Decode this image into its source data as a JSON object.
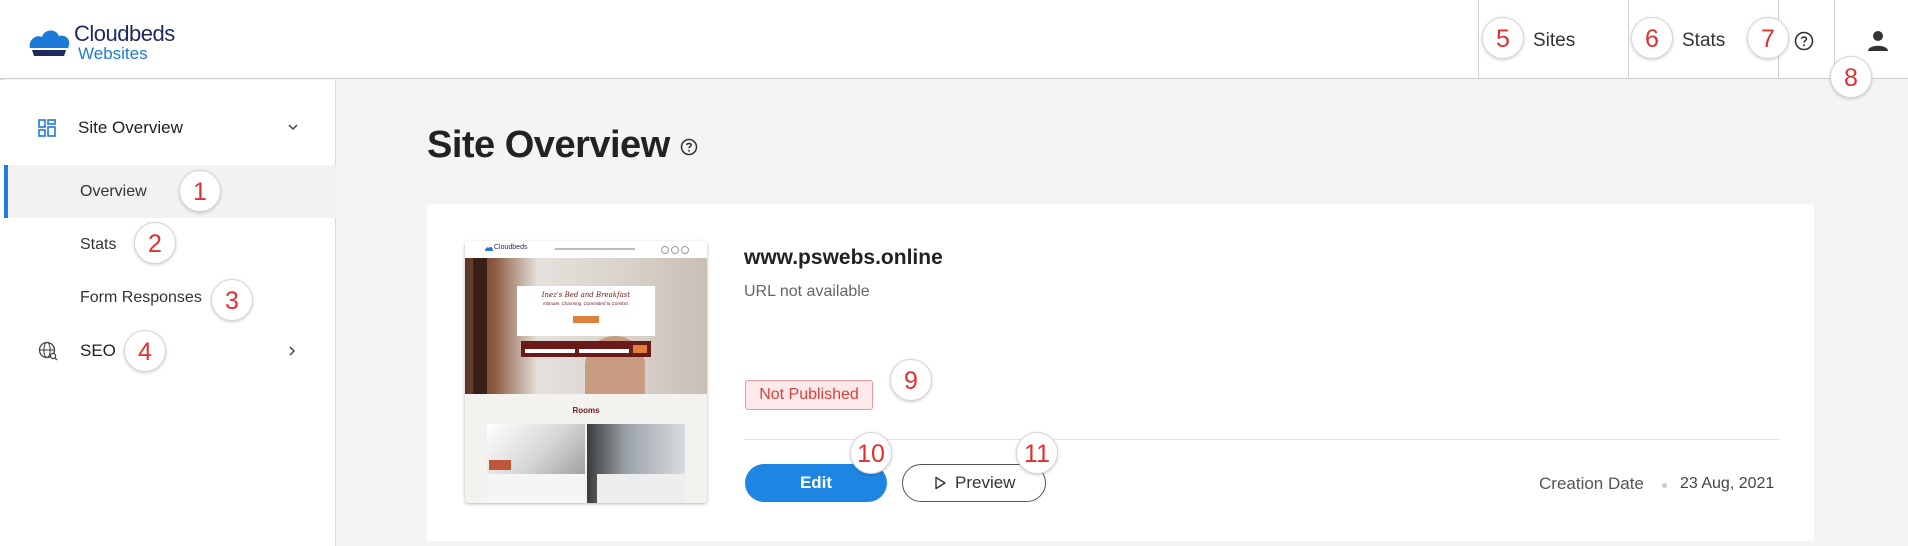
{
  "brand": {
    "name_line1": "Cloudbeds",
    "name_line2": "Websites",
    "primary_color": "#1e86e2",
    "navy": "#1c2b5a"
  },
  "header": {
    "sites_label": "Sites",
    "stats_label": "Stats",
    "help_icon": "question-circle-icon",
    "user_icon": "user-icon"
  },
  "sidebar": {
    "site_overview": "Site Overview",
    "items": [
      {
        "label": "Overview"
      },
      {
        "label": "Stats"
      },
      {
        "label": "Form Responses"
      }
    ],
    "seo": "SEO"
  },
  "main": {
    "title": "Site Overview",
    "site": {
      "name": "www.pswebs.online",
      "url_status": "URL not available",
      "status_badge": "Not Published",
      "edit_label": "Edit",
      "preview_label": "Preview",
      "creation_label": "Creation Date",
      "creation_date": "23 Aug, 2021"
    },
    "thumbnail": {
      "logo": "Cloudbeds",
      "hero_title": "Inez's Bed and Breakfast",
      "hero_subtitle": "Intimate. Charming. Committed to Comfort.",
      "section": "Rooms"
    }
  },
  "annotations": [
    "1",
    "2",
    "3",
    "4",
    "5",
    "6",
    "7",
    "8",
    "9",
    "10",
    "11"
  ]
}
